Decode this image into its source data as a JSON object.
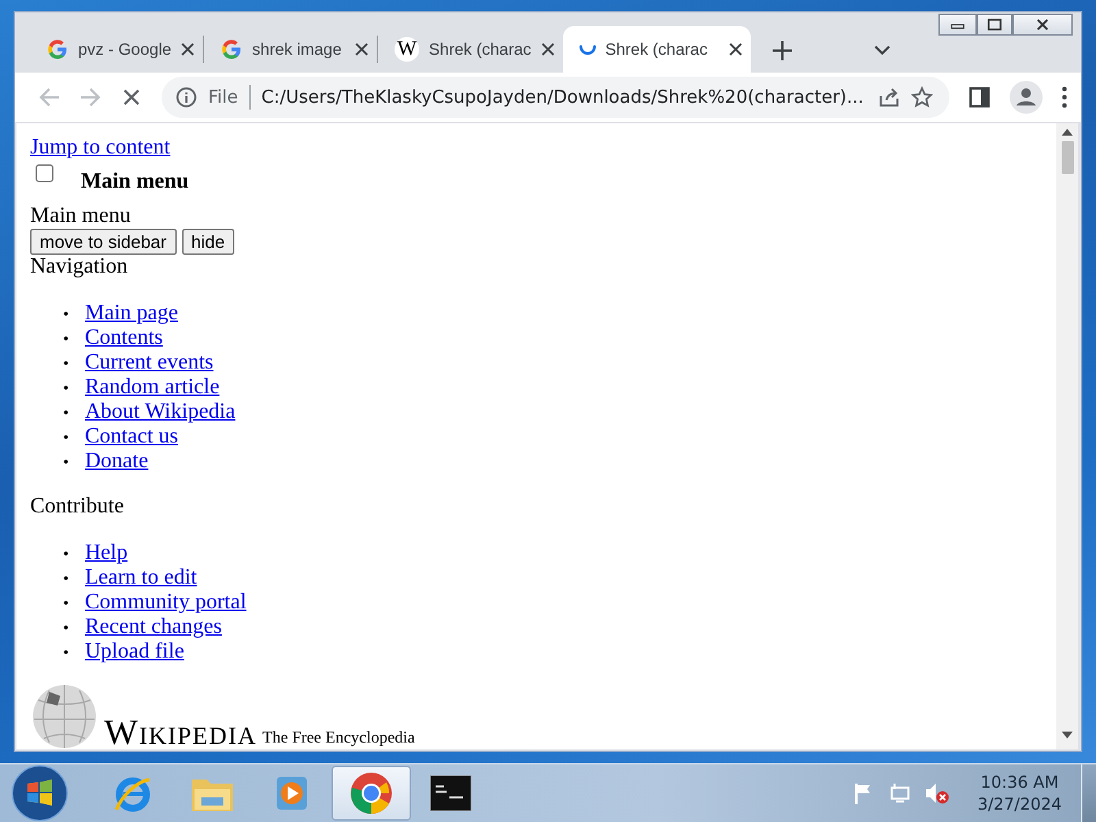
{
  "browser": {
    "tabs": [
      {
        "title": "pvz - Google",
        "kind": "google",
        "selected": false
      },
      {
        "title": "shrek image",
        "kind": "google",
        "selected": false
      },
      {
        "title": "Shrek (charac",
        "kind": "letter",
        "favicon_text": "W",
        "selected": false
      },
      {
        "title": "Shrek (charac",
        "kind": "spinner",
        "selected": true
      }
    ],
    "toolbar": {
      "loading": true,
      "scheme": "File",
      "url": "C:/Users/TheKlaskyCsupoJayden/Downloads/Shrek%20(character)..."
    }
  },
  "page": {
    "skip_link": "Jump to content",
    "menu_toggle": {
      "checked": false,
      "label": "Main menu"
    },
    "menu_title": "Main menu",
    "buttons": [
      "move to sidebar",
      "hide"
    ],
    "sections": [
      {
        "heading": "Navigation",
        "links": [
          {
            "bullet": "•",
            "label": "Main page"
          },
          {
            "bullet": "•",
            "label": "Contents"
          },
          {
            "bullet": "•",
            "label": "Current events"
          },
          {
            "bullet": "•",
            "label": "Random article"
          },
          {
            "bullet": "•",
            "label": "About Wikipedia"
          },
          {
            "bullet": "•",
            "label": "Contact us"
          },
          {
            "bullet": "•",
            "label": "Donate"
          }
        ]
      },
      {
        "heading": "Contribute",
        "links": [
          {
            "bullet": "•",
            "label": "Help"
          },
          {
            "bullet": "•",
            "label": "Learn to edit"
          },
          {
            "bullet": "•",
            "label": "Community portal"
          },
          {
            "bullet": "•",
            "label": "Recent changes"
          },
          {
            "bullet": "•",
            "label": "Upload file"
          }
        ]
      }
    ],
    "logo": {
      "wordmark": "Wikipedia",
      "tagline": "The Free Encyclopedia"
    }
  },
  "taskbar": {
    "apps": [
      {
        "kind": "ie",
        "selected": false
      },
      {
        "kind": "explorer",
        "selected": false
      },
      {
        "kind": "media",
        "selected": false
      },
      {
        "kind": "chrome",
        "selected": true
      },
      {
        "kind": "cmd",
        "selected": false
      }
    ],
    "clock": {
      "time": "10:36 AM",
      "date": "3/27/2024"
    }
  }
}
